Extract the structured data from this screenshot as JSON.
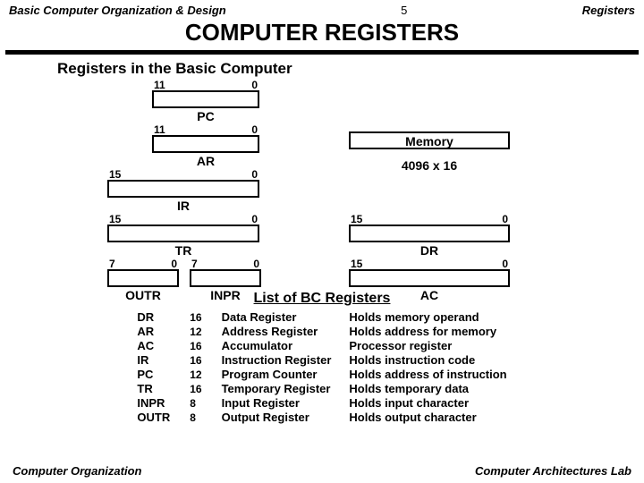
{
  "header": {
    "left": "Basic Computer Organization & Design",
    "center": "5",
    "right": "Registers"
  },
  "title": "COMPUTER  REGISTERS",
  "subtitle": "Registers in the Basic Computer",
  "regs": {
    "pc": {
      "hi": "11",
      "lo": "0",
      "label": "PC"
    },
    "ar": {
      "hi": "11",
      "lo": "0",
      "label": "AR"
    },
    "ir": {
      "hi": "15",
      "lo": "0",
      "label": "IR"
    },
    "tr": {
      "hi": "15",
      "lo": "0",
      "label": "TR"
    },
    "dr": {
      "hi": "15",
      "lo": "0",
      "label": "DR"
    },
    "outr": {
      "hi": "7",
      "lo": "0",
      "label": "OUTR"
    },
    "inpr": {
      "hi": "7",
      "lo": "0",
      "label": "INPR"
    },
    "ac": {
      "hi": "15",
      "lo": "0",
      "label": "AC"
    }
  },
  "memory": {
    "label": "Memory",
    "size": "4096 x 16"
  },
  "list_header": "List of BC Registers",
  "list": [
    {
      "abbr": "DR",
      "width": "16",
      "name": "Data Register",
      "desc": "Holds memory operand"
    },
    {
      "abbr": "AR",
      "width": "12",
      "name": "Address Register",
      "desc": "Holds address for memory"
    },
    {
      "abbr": "AC",
      "width": "16",
      "name": "Accumulator",
      "desc": "Processor register"
    },
    {
      "abbr": "IR",
      "width": "16",
      "name": "Instruction Register",
      "desc": "Holds instruction code"
    },
    {
      "abbr": "PC",
      "width": "12",
      "name": "Program Counter",
      "desc": "Holds address of instruction"
    },
    {
      "abbr": "TR",
      "width": "16",
      "name": "Temporary Register",
      "desc": "Holds temporary data"
    },
    {
      "abbr": "INPR",
      "width": "8",
      "name": "Input Register",
      "desc": "Holds input character"
    },
    {
      "abbr": "OUTR",
      "width": "8",
      "name": "Output Register",
      "desc": "Holds output character"
    }
  ],
  "footer": {
    "left": "Computer Organization",
    "right": "Computer Architectures Lab"
  }
}
